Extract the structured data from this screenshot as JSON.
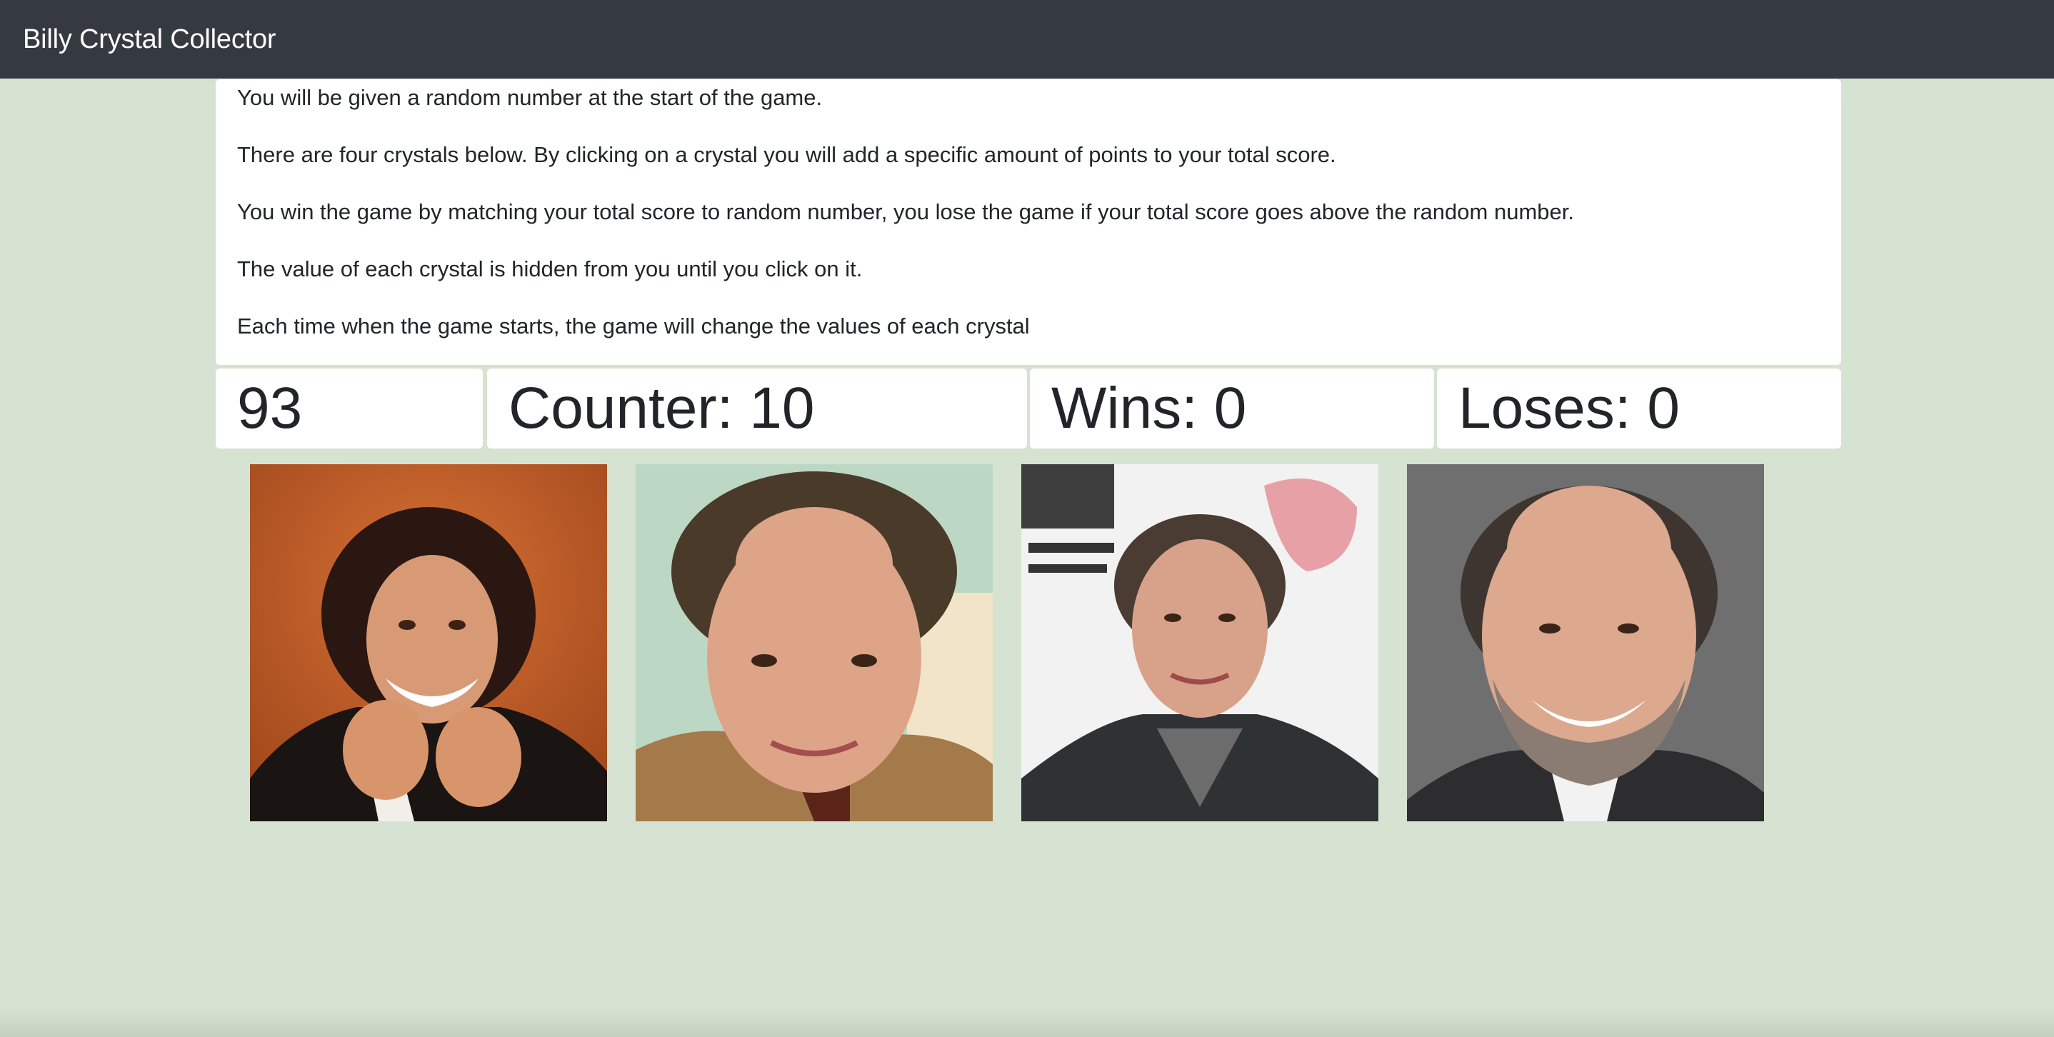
{
  "navbar": {
    "brand": "Billy Crystal Collector"
  },
  "instructions": [
    "You will be given a random number at the start of the game.",
    "There are four crystals below. By clicking on a crystal you will add a specific amount of points to your total score.",
    "You win the game by matching your total score to random number, you lose the game if your total score goes above the random number.",
    "The value of each crystal is hidden from you until you click on it.",
    "Each time when the game starts, the game will change the values of each crystal"
  ],
  "stats": {
    "target": "93",
    "counter": "Counter: 10",
    "wins": "Wins: 0",
    "loses": "Loses: 0"
  },
  "crystals": [
    {
      "icon": "billy-crystal-portrait-1",
      "background": "#c8622a"
    },
    {
      "icon": "billy-crystal-portrait-2",
      "background": "#bcd8c4"
    },
    {
      "icon": "billy-crystal-portrait-3",
      "background": "#f2f2f2"
    },
    {
      "icon": "billy-crystal-portrait-4",
      "background": "#6f6f6f"
    }
  ],
  "colors": {
    "page_background": "#d7e3d2",
    "navbar": "#343a40",
    "card": "#ffffff",
    "text": "#212529"
  }
}
